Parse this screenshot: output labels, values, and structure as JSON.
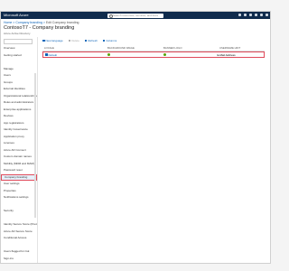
{
  "window": {
    "brand": "Microsoft Azure",
    "search_placeholder": "Search resources, services, and docs"
  },
  "breadcrumb": {
    "item1": "Home >",
    "item2": "Company branding >",
    "item3": "Edit Company branding"
  },
  "page": {
    "title": "ContosoT7 - Company branding",
    "subtitle": "Azure Active Directory"
  },
  "sidebar": {
    "items": [
      "Overview",
      "Getting started",
      "",
      "Manage",
      "Users",
      "Groups",
      "External Identities",
      "Organizational relationships",
      "Roles and administrators",
      "Enterprise applications",
      "Devices",
      "App registrations",
      "Identity Governance",
      "Application proxy",
      "Licenses",
      "Azure AD Connect",
      "Custom domain names",
      "Mobility (MDM and MAM)",
      "Password reset",
      "Company branding",
      "User settings",
      "Properties",
      "Notifications settings",
      "",
      "Security",
      "",
      "Identity Secure Score (Preview)",
      "Azure AD Secure Score",
      "Conditional Access",
      "",
      "Users flagged for risk",
      "Sign-ins",
      "Authentication methods"
    ],
    "active_index": 19
  },
  "toolbar": {
    "new_language": "New language",
    "delete": "Delete",
    "refresh": "Refresh",
    "columns": "Columns"
  },
  "table": {
    "headers": [
      "LOCALE",
      "BACKGROUND IMAGE",
      "BANNER LOGO",
      "USERNAME HINT"
    ],
    "row": {
      "locale": "Default",
      "username_hint": "E-Mail Address"
    }
  },
  "colors": {
    "accent": "#0b62b7",
    "topbar": "#0f2b4c",
    "highlight": "#e04a5a",
    "ok": "#57a300"
  }
}
